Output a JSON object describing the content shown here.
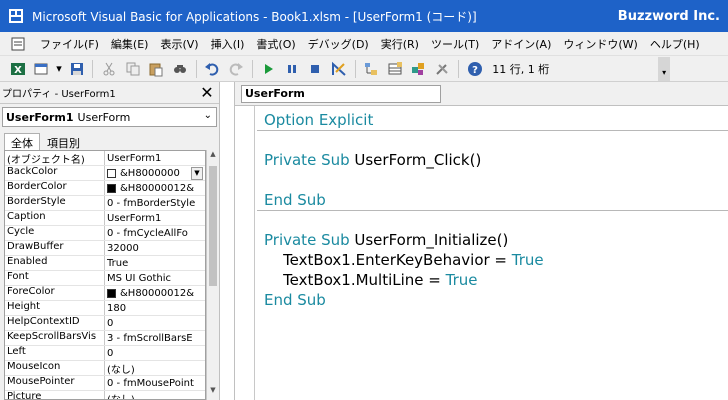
{
  "window": {
    "title": "Microsoft Visual Basic for Applications - Book1.xlsm - [UserForm1 (コード)]",
    "brand": "Buzzword Inc."
  },
  "menu": {
    "items": [
      "ファイル(F)",
      "編集(E)",
      "表示(V)",
      "挿入(I)",
      "書式(O)",
      "デバッグ(D)",
      "実行(R)",
      "ツール(T)",
      "アドイン(A)",
      "ウィンドウ(W)",
      "ヘルプ(H)"
    ]
  },
  "toolbar": {
    "status": "11 行, 1 桁"
  },
  "properties": {
    "title": "プロパティ - UserForm1",
    "object_name": "UserForm1",
    "object_type": "UserForm",
    "tabs": [
      "全体",
      "項目別"
    ],
    "rows": [
      {
        "name": "(オブジェクト名)",
        "value": "UserForm1"
      },
      {
        "name": "BackColor",
        "value": "&H8000000",
        "swatch": "#ffffff",
        "dropdown": true
      },
      {
        "name": "BorderColor",
        "value": "&H80000012&",
        "swatch": "#000000"
      },
      {
        "name": "BorderStyle",
        "value": "0 - fmBorderStyle"
      },
      {
        "name": "Caption",
        "value": "UserForm1"
      },
      {
        "name": "Cycle",
        "value": "0 - fmCycleAllFo"
      },
      {
        "name": "DrawBuffer",
        "value": "32000"
      },
      {
        "name": "Enabled",
        "value": "True"
      },
      {
        "name": "Font",
        "value": "MS UI Gothic"
      },
      {
        "name": "ForeColor",
        "value": "&H80000012&",
        "swatch": "#000000"
      },
      {
        "name": "Height",
        "value": "180"
      },
      {
        "name": "HelpContextID",
        "value": "0"
      },
      {
        "name": "KeepScrollBarsVis",
        "value": "3 - fmScrollBarsE"
      },
      {
        "name": "Left",
        "value": "0"
      },
      {
        "name": "MouseIcon",
        "value": "(なし)"
      },
      {
        "name": "MousePointer",
        "value": "0 - fmMousePoint"
      },
      {
        "name": "Picture",
        "value": "(なし)"
      }
    ]
  },
  "code": {
    "object_combo": "UserForm",
    "lines": {
      "option": "Option Explicit",
      "sub1_kw": "Private Sub ",
      "sub1_name": "UserForm_Click()",
      "end1": "End Sub",
      "sub2_kw": "Private Sub ",
      "sub2_name": "UserForm_Initialize()",
      "l3_a": "    TextBox1.EnterKeyBehavior = ",
      "l3_b": "True",
      "l4_a": "    TextBox1.MultiLine = ",
      "l4_b": "True",
      "end2": "End Sub"
    }
  }
}
